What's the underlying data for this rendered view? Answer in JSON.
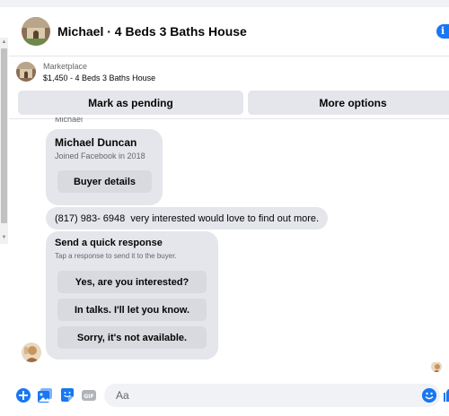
{
  "header": {
    "title": "Michael · 4 Beds 3 Baths House",
    "info_icon": "info-icon",
    "info_glyph": "i"
  },
  "marketplace": {
    "label": "Marketplace",
    "item": "$1,450 - 4 Beds 3 Baths House",
    "pending_label": "Mark as pending",
    "more_label": "More options"
  },
  "chat": {
    "clipped_sender": "Michael",
    "buyer_card": {
      "name": "Michael Duncan",
      "subtitle": "Joined Facebook in 2018",
      "button_label": "Buyer details"
    },
    "message": "(817) 983- 6948  very interested would love to find out more.",
    "quick_response": {
      "title": "Send a quick response",
      "subtitle": "Tap a response to send it to the buyer.",
      "options": [
        "Yes, are you interested?",
        "In talks. I'll let you know.",
        "Sorry, it's not available."
      ]
    }
  },
  "composer": {
    "placeholder": "Aa",
    "icons": [
      "plus-circle-icon",
      "photo-icon",
      "sticker-icon",
      "gif-icon",
      "emoji-icon",
      "like-icon"
    ]
  },
  "colors": {
    "accent": "#1877f2",
    "bubble": "#e4e6eb",
    "button": "#d8dadf",
    "muted_text": "#65676b"
  }
}
